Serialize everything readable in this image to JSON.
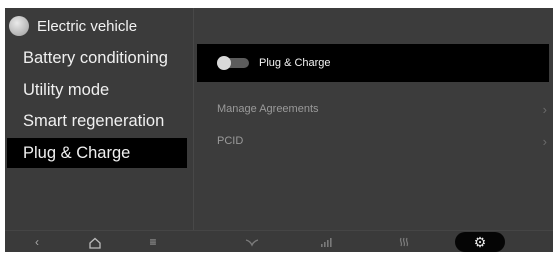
{
  "header": {
    "title": "Electric vehicle"
  },
  "menu": {
    "items": [
      {
        "label": "Battery conditioning"
      },
      {
        "label": "Utility mode"
      },
      {
        "label": "Smart regeneration"
      },
      {
        "label": "Plug & Charge"
      }
    ],
    "selected": "Plug & Charge"
  },
  "content": {
    "plug_charge": {
      "label": "Plug & Charge",
      "enabled": false
    },
    "rows": [
      {
        "label": "Manage Agreements"
      },
      {
        "label": "PCID"
      }
    ]
  },
  "bottom_bar": {
    "icons": [
      "back-icon",
      "home-icon",
      "menu-icon",
      "fan-icon",
      "signal-icon",
      "seat-heat-icon",
      "settings-icon"
    ],
    "active": "settings-icon"
  },
  "colors": {
    "background": "#3a3a3a",
    "selected": "#000000",
    "text": "#f0f0f0",
    "muted_text": "#9a9a9a"
  }
}
